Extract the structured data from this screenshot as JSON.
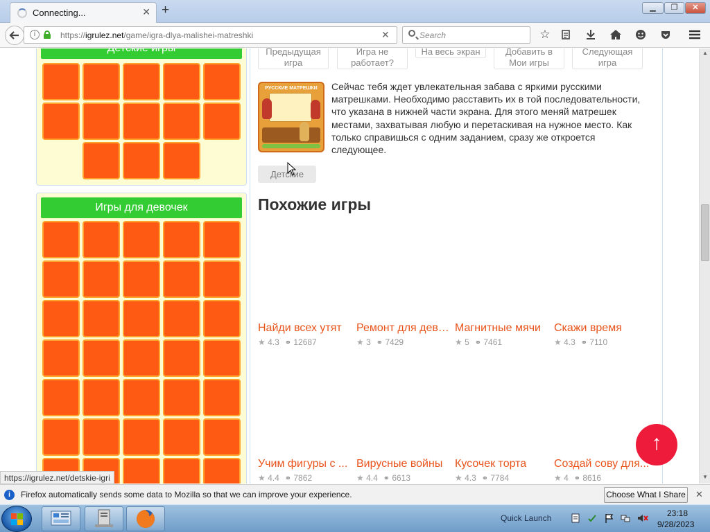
{
  "browser": {
    "tab_title": "Connecting...",
    "new_tab": "+",
    "window_min": "▁",
    "window_max": "❐",
    "window_close": "✕",
    "url_prefix": "https://",
    "url_host": "igrulez.net",
    "url_path": "/game/igra-dlya-malishei-matreshki",
    "search_placeholder": "Search"
  },
  "sidebar": {
    "box1_title": "Детские игры",
    "box2_title": "Игры для девочек"
  },
  "actions": [
    {
      "line1": "Предыдущая",
      "line2": "игра"
    },
    {
      "line1": "Игра не",
      "line2": "работает?"
    },
    {
      "line1": "На весь экран",
      "line2": ""
    },
    {
      "line1": "Добавить в",
      "line2": "Мои игры"
    },
    {
      "line1": "Следующая",
      "line2": "игра"
    }
  ],
  "game": {
    "thumb_title": "РУССКИЕ МАТРЕШКИ",
    "description": "Сейчас тебя ждет увлекательная забава с яркими русскими матрешками. Необходимо расставить их в той последовательности, что указана в нижней части экрана. Для этого меняй матрешек местами, захватывая любую и перетаскивая на нужное место. Как только справишься с одним заданием, сразу же откроется следующее.",
    "tag": "Детские"
  },
  "similar": {
    "heading": "Похожие игры",
    "games": [
      {
        "title": "Найди всех утят",
        "rating": "4.3",
        "plays": "12687"
      },
      {
        "title": "Ремонт для девочки",
        "rating": "3",
        "plays": "7429"
      },
      {
        "title": "Магнитные мячи",
        "rating": "5",
        "plays": "7461"
      },
      {
        "title": "Скажи время",
        "rating": "4.3",
        "plays": "7110"
      },
      {
        "title": "Учим фигуры с ...",
        "rating": "4.4",
        "plays": "7862"
      },
      {
        "title": "Вирусные войны",
        "rating": "4.4",
        "plays": "6613"
      },
      {
        "title": "Кусочек торта",
        "rating": "4.3",
        "plays": "7784"
      },
      {
        "title": "Создай сову для...",
        "rating": "4",
        "plays": "8616"
      }
    ]
  },
  "scroll_top": "↑",
  "status_link": "https://igrulez.net/detskie-igri",
  "notification": {
    "text": "Firefox automatically sends some data to Mozilla so that we can improve your experience.",
    "button": "Choose What I Share",
    "close": "✕"
  },
  "taskbar": {
    "quick_launch": "Quick Launch",
    "time": "23:18",
    "date": "9/28/2023"
  },
  "colors": {
    "tile": "#ff5a14",
    "tile_border": "#ffa32a",
    "header_green": "#33cc33",
    "link_orange": "#e8541c",
    "scroll_top_red": "#ee1c3a"
  }
}
